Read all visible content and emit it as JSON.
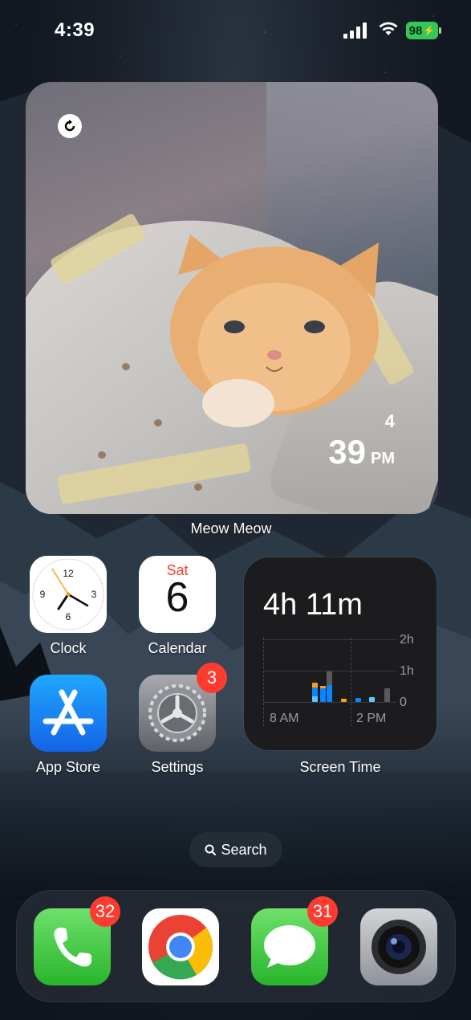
{
  "status_bar": {
    "time": "4:39",
    "battery": "98"
  },
  "photo_widget": {
    "hour": "4",
    "minute": "39",
    "ampm": "PM",
    "label": "Meow Meow"
  },
  "apps": {
    "clock": {
      "label": "Clock"
    },
    "calendar": {
      "label": "Calendar",
      "weekday": "Sat",
      "day": "6"
    },
    "app_store": {
      "label": "App Store"
    },
    "settings": {
      "label": "Settings",
      "badge": "3"
    }
  },
  "screen_time": {
    "label": "Screen Time",
    "total": "4h 11m",
    "y_ticks": [
      "2h",
      "1h",
      "0"
    ],
    "x_ticks": [
      "8 AM",
      "2 PM"
    ]
  },
  "search": {
    "label": "Search"
  },
  "dock": {
    "phone": {
      "badge": "32"
    },
    "messages": {
      "badge": "31"
    }
  },
  "colors": {
    "badge": "#ff3b30",
    "battery": "#34c759",
    "accent": "#0a84ff"
  }
}
